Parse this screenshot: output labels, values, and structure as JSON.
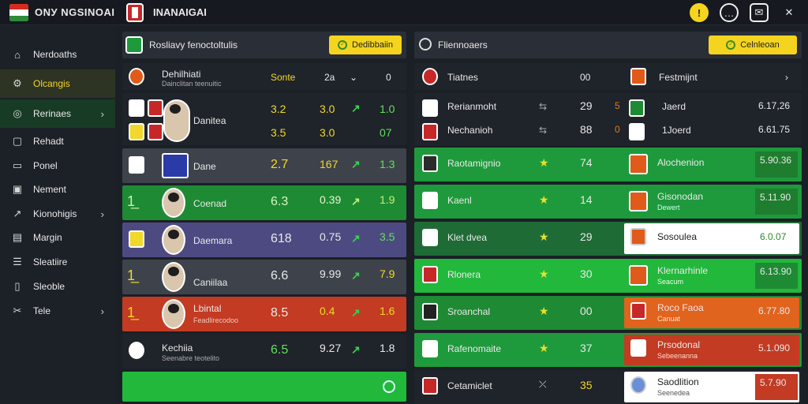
{
  "app": {
    "title": "ОNУ NGSINOAI",
    "page_title": "INANAIGAI"
  },
  "sidebar": {
    "items": [
      {
        "label": "Nerdoaths",
        "icon": "home-icon"
      },
      {
        "label": "Olcangis",
        "icon": "gear-icon"
      },
      {
        "label": "Rerinaes",
        "icon": "globe-icon"
      },
      {
        "label": "Rehadt",
        "icon": "square-icon"
      },
      {
        "label": "Ponel",
        "icon": "doc-icon"
      },
      {
        "label": "Nement",
        "icon": "chart-icon"
      },
      {
        "label": "Kionohigis",
        "icon": "pulse-icon"
      },
      {
        "label": "Margin",
        "icon": "monitor-icon"
      },
      {
        "label": "Sleatiire",
        "icon": "list-icon"
      },
      {
        "label": "Sleoble",
        "icon": "box-icon"
      },
      {
        "label": "Tele",
        "icon": "tools-icon"
      }
    ]
  },
  "left_panel": {
    "title": "Rosliavy fenoctoltulis",
    "button": "Dedibbaiin",
    "header": {
      "name": "Dehilhiati",
      "sub": "Dainclitan teenuitic",
      "c1": "Sonte",
      "c2": "2a",
      "c3": "0"
    },
    "rows": [
      {
        "name": "Danitea",
        "v1": "3.2",
        "v1b": "3.5",
        "v2": "3.0",
        "v2b": "3.0",
        "v3": "1.0",
        "v3b": "07"
      },
      {
        "name": "Dane",
        "v1": "2.7",
        "v2": "167",
        "v3": "1.3"
      },
      {
        "name": "Coenad",
        "v1": "6.3",
        "v2": "0.39",
        "v3": "1.9"
      },
      {
        "name": "Daemara",
        "v1": "618",
        "v2": "0.75",
        "v3": "3.5"
      },
      {
        "name": "Caniilaa",
        "v1": "6.6",
        "v2": "9.99",
        "v3": "7.9"
      },
      {
        "name": "Lbintal",
        "sub": "Feadlirecodoo",
        "v1": "8.5",
        "v2": "0.4",
        "v3": "1.6"
      },
      {
        "name": "Kechiia",
        "sub": "Seenabre teotelito",
        "v1": "6.5",
        "v2": "9.27",
        "v3": "1.8"
      }
    ]
  },
  "right_panel": {
    "title": "Fliennoaers",
    "button": "Celnleoan",
    "header": {
      "left": "Tiatnes",
      "mid": "00",
      "right": "Festmijnt"
    },
    "rows": [
      {
        "left": "Rerianmoht",
        "mid": "29",
        "num": "5",
        "right": "Jaerd",
        "val": "6.17,26"
      },
      {
        "left": "Nechanioh",
        "mid": "88",
        "num": "0",
        "right": "1Joerd",
        "val": "6.61.75"
      },
      {
        "left": "Raotamignio",
        "mid": "74",
        "right": "Alochenion",
        "val": "5.90.36"
      },
      {
        "left": "Kaenl",
        "mid": "14",
        "right": "Gisonodan",
        "sub": "Dewert",
        "val": "5.11.90"
      },
      {
        "left": "Klet dvea",
        "mid": "29",
        "right": "Sosoulea",
        "val": "6.0.07"
      },
      {
        "left": "Rlonera",
        "mid": "30",
        "right": "Klernarhinle",
        "sub": "Seacum",
        "val": "6.13.90"
      },
      {
        "left": "Sroanchal",
        "mid": "00",
        "right": "Roco Faoa",
        "sub": "Canuat",
        "val": "6.77.80"
      },
      {
        "left": "Rafenomaite",
        "mid": "37",
        "right": "Prsodonal",
        "sub": "Sebeenanna",
        "val": "5.1.090"
      },
      {
        "left": "Cetamiclet",
        "mid": "35",
        "right": "Saodlition",
        "sub": "Seenedea",
        "val": "5.7.90"
      }
    ]
  },
  "colors": {
    "accent": "#f5d41f",
    "green": "#1e8a34",
    "red": "#c23b22",
    "purple": "#4d4a82"
  }
}
